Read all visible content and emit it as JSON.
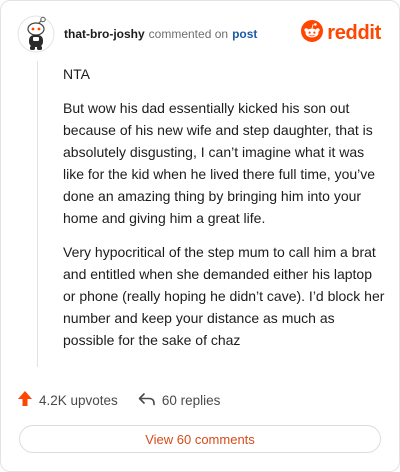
{
  "header": {
    "username": "that-bro-joshy",
    "action_text": "commented on",
    "post_link": "post",
    "brand_name": "reddit"
  },
  "comment": {
    "paragraphs": [
      "NTA",
      "But wow his dad essentially kicked his son out because of his new wife and step daughter, that is absolutely disgusting, I can’t imagine what it was like for the kid when he lived there full time, you’ve done an amazing thing by bringing him into your home and giving him a great life.",
      "Very hypocritical of the step mum to call him a brat and entitled when she demanded either his laptop or phone (really hoping he didn’t cave). I’d block her number and keep your distance as much as possible for the sake of chaz"
    ]
  },
  "actions": {
    "upvotes": "4.2K upvotes",
    "replies": "60 replies"
  },
  "view_button": "View 60 comments",
  "colors": {
    "brand": "#ff4500",
    "upvote": "#ff4500",
    "link": "#1a5aa8"
  },
  "icons": {
    "avatar": "snoo-avatar-icon",
    "brand": "reddit-logo-icon",
    "upvote": "upvote-arrow-icon",
    "reply": "reply-arrow-icon"
  }
}
